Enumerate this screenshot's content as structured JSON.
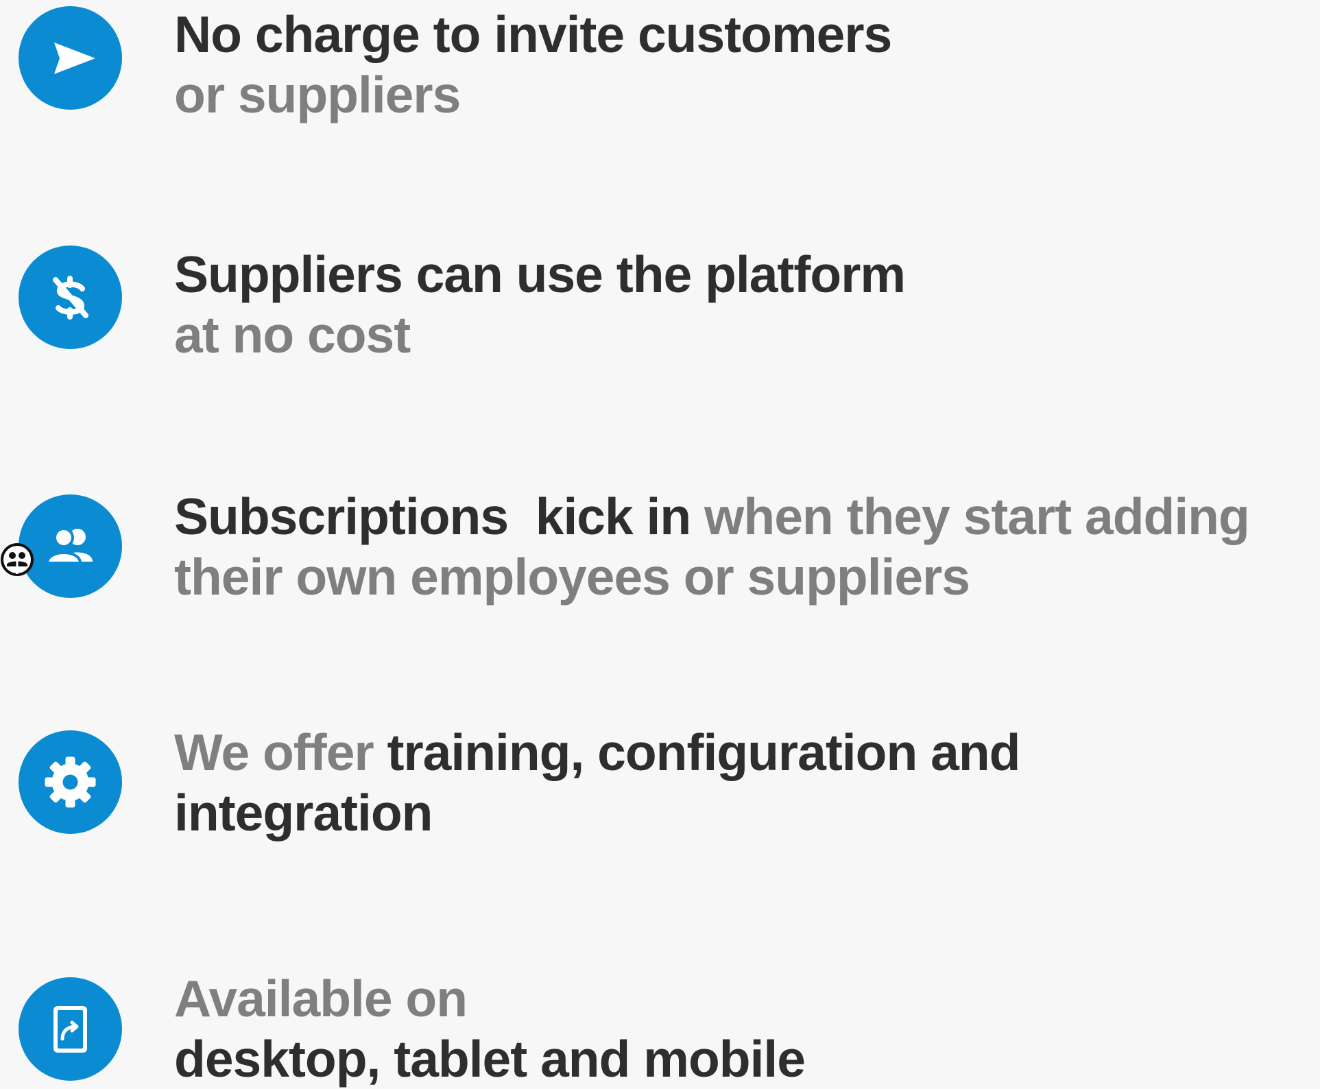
{
  "colors": {
    "accent": "#0a8bd2",
    "heading": "#2e2e2e",
    "muted": "#7f7f7f",
    "background": "#f7f7f7"
  },
  "features": [
    {
      "icon": "paper-plane-icon",
      "line1": [
        {
          "text": "No charge to invite customers",
          "tone": "dark"
        }
      ],
      "line2": [
        {
          "text": "or suppliers",
          "tone": "grey"
        }
      ]
    },
    {
      "icon": "no-dollar-icon",
      "line1": [
        {
          "text": "Suppliers can use the platform",
          "tone": "dark"
        }
      ],
      "line2": [
        {
          "text": "at no cost",
          "tone": "grey"
        }
      ]
    },
    {
      "icon": "users-icon",
      "line1": [
        {
          "text": "Subscriptions  kick in",
          "tone": "dark"
        },
        {
          "text": " when they start adding",
          "tone": "grey"
        }
      ],
      "line2": [
        {
          "text": "their own employees or suppliers",
          "tone": "grey"
        }
      ]
    },
    {
      "icon": "gear-icon",
      "line1": [
        {
          "text": "We offer",
          "tone": "grey"
        },
        {
          "text": " training, configuration and",
          "tone": "dark"
        }
      ],
      "line2": [
        {
          "text": "integration",
          "tone": "dark"
        }
      ]
    },
    {
      "icon": "tablet-share-icon",
      "line1": [
        {
          "text": "Available on",
          "tone": "grey"
        }
      ],
      "line2": [
        {
          "text": "desktop, tablet and mobile",
          "tone": "dark"
        }
      ]
    }
  ],
  "accessibility_widget": {
    "icon": "accessibility-icon"
  }
}
